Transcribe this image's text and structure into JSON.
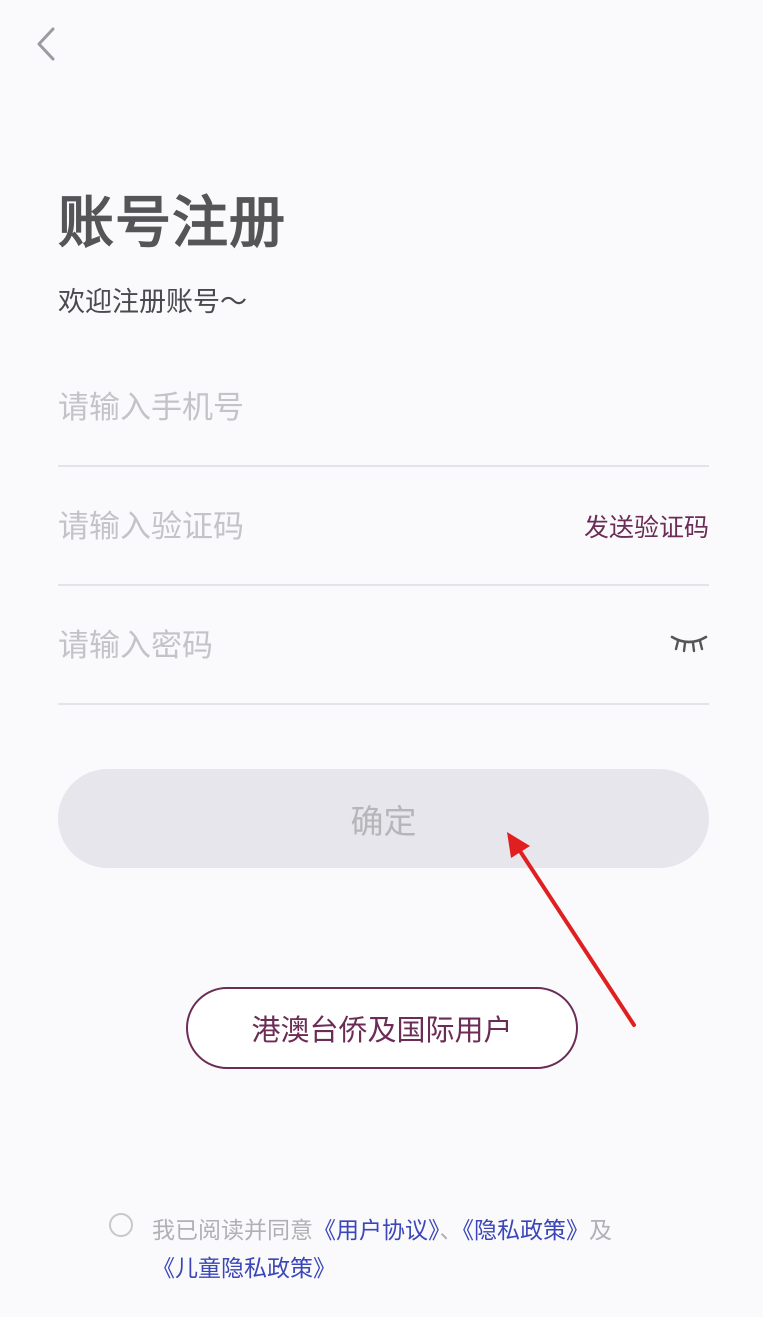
{
  "header": {
    "back_icon": "chevron-left-icon"
  },
  "title": "账号注册",
  "subtitle": "欢迎注册账号～",
  "fields": {
    "phone": {
      "placeholder": "请输入手机号",
      "value": ""
    },
    "code": {
      "placeholder": "请输入验证码",
      "value": "",
      "send_label": "发送验证码"
    },
    "password": {
      "placeholder": "请输入密码",
      "value": "",
      "toggle_icon": "eye-closed-icon"
    }
  },
  "confirm_label": "确定",
  "intl_label": "港澳台侨及国际用户",
  "agreement": {
    "prefix": "我已阅读并同意",
    "user_agreement": "《用户协议》",
    "sep": "、",
    "privacy_policy": "《隐私政策》",
    "and": "及",
    "child_privacy": "《儿童隐私政策》"
  },
  "colors": {
    "accent": "#6b2c55",
    "link": "#3b47b8",
    "annotation_arrow": "#e02020",
    "button_disabled_bg": "#e7e6ec"
  }
}
